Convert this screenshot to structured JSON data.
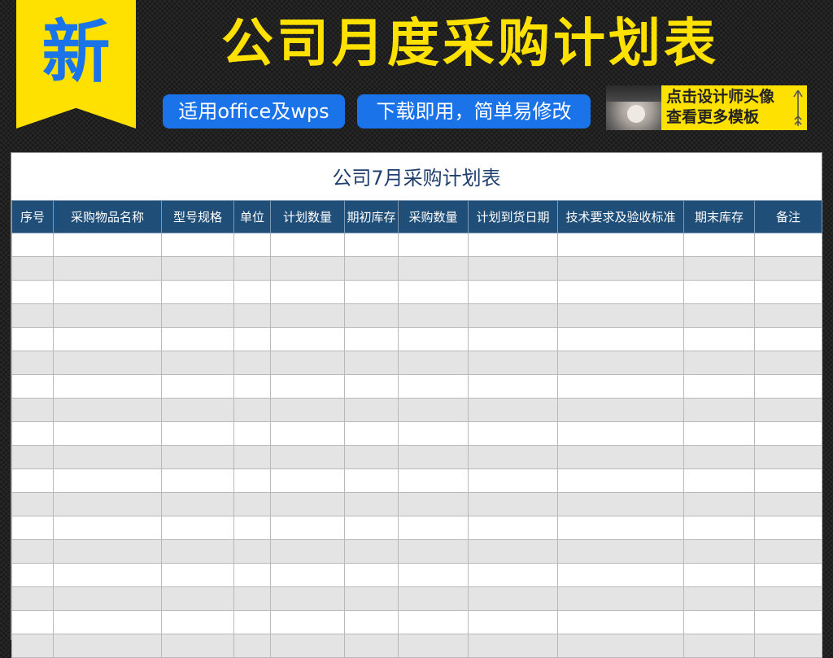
{
  "banner": {
    "badge": "新",
    "title": "公司月度采购计划表",
    "pill_1": "适用office及wps",
    "pill_2": "下载即用，简单易修改",
    "promo_line_1": "点击设计师头像",
    "promo_line_2": "查看更多模板",
    "promo_icon": "arrow-up-icon"
  },
  "sheet": {
    "title": "公司7月采购计划表",
    "columns": [
      "序号",
      "采购物品名称",
      "型号规格",
      "单位",
      "计划数量",
      "期初库存",
      "采购数量",
      "计划到货日期",
      "技术要求及验收标准",
      "期末库存",
      "备注"
    ],
    "header_color": "#1f4e79",
    "stripe_color": "#e4e4e4"
  },
  "colors": {
    "accent_yellow": "#ffe100",
    "accent_blue": "#1a73e8"
  }
}
